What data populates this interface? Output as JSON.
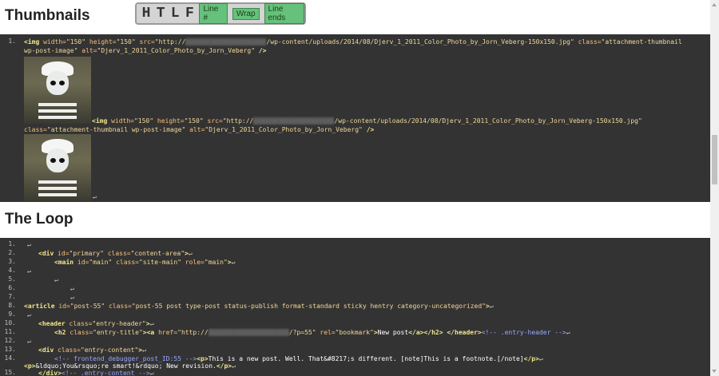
{
  "sections": {
    "thumbnails_title": "Thumbnails",
    "loop_title": "The Loop"
  },
  "toolbar": {
    "h": "H",
    "t": "T",
    "l": "L",
    "f": "F",
    "line_numbers": "Line #",
    "wrap": "Wrap",
    "line_ends": "Line ends"
  },
  "thumbnails_code": {
    "line1_no": "1.",
    "img1_tag": "<img",
    "img1_width_attr": " width=",
    "img1_width_val": "\"150\"",
    "img1_height_attr": " height=",
    "img1_height_val": "\"150\"",
    "img1_src_attr": " src=",
    "img1_src_prefix": "\"http://",
    "img1_src_path": "/wp-content/uploads/2014/08/Djerv_1_2011_Color_Photo_by_Jorn_Veberg-150x150.jpg\"",
    "img1_class_attr": " class=",
    "img1_class_val1": "\"attachment-thumbnail",
    "img1_class_val2": "wp-post-image\"",
    "img1_alt_attr": " alt=",
    "img1_alt_val": "\"Djerv_1_2011_Color_Photo_by_Jorn_Veberg\"",
    "img1_close": " />",
    "img2_tag": "<img",
    "img2_close": " />",
    "newline": "↵"
  },
  "loop_code": {
    "lines": [
      {
        "no": "1."
      },
      {
        "no": "2."
      },
      {
        "no": "3."
      },
      {
        "no": "4."
      },
      {
        "no": "5."
      },
      {
        "no": "6."
      },
      {
        "no": "7."
      },
      {
        "no": "8."
      },
      {
        "no": "9."
      },
      {
        "no": "10."
      },
      {
        "no": "11."
      },
      {
        "no": "12."
      },
      {
        "no": "13."
      },
      {
        "no": "14."
      },
      {
        "no": "15."
      }
    ],
    "l2_tag": "<div",
    "l2_id_attr": " id=",
    "l2_id_val": "\"primary\"",
    "l2_class_attr": " class=",
    "l2_class_val": "\"content-area\"",
    "l2_end": ">",
    "l3_tag": "<main",
    "l3_id_attr": " id=",
    "l3_id_val": "\"main\"",
    "l3_class_attr": " class=",
    "l3_class_val": "\"site-main\"",
    "l3_role_attr": " role=",
    "l3_role_val": "\"main\"",
    "l3_end": ">",
    "l8_tag": "<article",
    "l8_id_attr": " id=",
    "l8_id_val": "\"post-55\"",
    "l8_class_attr": " class=",
    "l8_class_val": "\"post-55 post type-post status-publish format-standard sticky hentry category-uncategorized\"",
    "l8_end": ">",
    "l10_tag": "<header",
    "l10_class_attr": " class=",
    "l10_class_val": "\"entry-header\"",
    "l10_end": ">",
    "l11_h2": "<h2",
    "l11_class_attr": " class=",
    "l11_class_val": "\"entry-title\"",
    "l11_a": "><a",
    "l11_href_attr": " href=",
    "l11_href_prefix": "\"http://",
    "l11_href_suffix": "/?p=55\"",
    "l11_rel_attr": " rel=",
    "l11_rel_val": "\"bookmark\"",
    "l11_gt": ">",
    "l11_text": "New post",
    "l11_close": "</a></h2>",
    "l11_header_close": " </header>",
    "l11_comment": "<!-- .entry-header -->",
    "l13_tag": "<div",
    "l13_class_attr": " class=",
    "l13_class_val": "\"entry-content\"",
    "l13_end": ">",
    "l14_comment": "<!-- frontend_debugger_post_ID:55 -->",
    "l14_p": "<p>",
    "l14_text": "This is a new post. Well. That&#8217;s different. [note]This is a footnote.[/note]",
    "l14_pclose": "</p>",
    "l14b_p": "<p>",
    "l14b_text": "&ldquo;You&rsquo;re smart!&rdquo; New revision.",
    "l14b_pclose": "</p>",
    "l15_close": "</div>",
    "l15_comment": "<!-- .entry-content -->"
  }
}
